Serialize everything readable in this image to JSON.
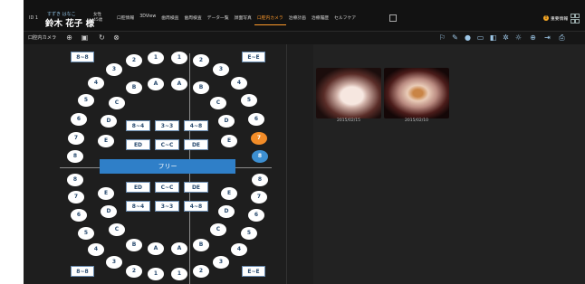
{
  "header": {
    "patient_id": "ID 1",
    "patient_kana": "すずき はなこ",
    "patient_name": "鈴木 花子 様",
    "patient_gender": "女性",
    "patient_age": "45歳",
    "tabs": [
      "口腔情報",
      "3DView",
      "歯周検査",
      "歯周検査",
      "データ一覧",
      "顔面写真",
      "口腔内カメラ",
      "治療計画",
      "治療履歴",
      "セルフケア"
    ],
    "active_tab": "口腔内カメラ",
    "notice_label": "重要情報"
  },
  "toolbar": {
    "title": "口腔内カメラ"
  },
  "chart": {
    "free_label": "フリー",
    "tags": {
      "ul": "8~8",
      "ur": "E~E",
      "ll": "8~8",
      "lr": "E~E",
      "r1a": "8~4",
      "r1b": "3~3",
      "r1c": "4~8",
      "r2a": "ED",
      "r2b": "C~C",
      "r2c": "DE",
      "r3a": "ED",
      "r3b": "C~C",
      "r3c": "DE",
      "r4a": "8~4",
      "r4b": "3~3",
      "r4c": "4~8"
    },
    "teeth": [
      {
        "label": "2"
      },
      {
        "label": "1"
      },
      {
        "label": "1"
      },
      {
        "label": "2"
      },
      {
        "label": "3"
      },
      {
        "label": "3"
      },
      {
        "label": "4"
      },
      {
        "label": "B"
      },
      {
        "label": "A"
      },
      {
        "label": "A"
      },
      {
        "label": "B"
      },
      {
        "label": "4"
      },
      {
        "label": "5"
      },
      {
        "label": "C"
      },
      {
        "label": "C"
      },
      {
        "label": "5"
      },
      {
        "label": "6"
      },
      {
        "label": "D"
      },
      {
        "label": "D"
      },
      {
        "label": "6"
      },
      {
        "label": "7"
      },
      {
        "label": "E"
      },
      {
        "label": "E"
      },
      {
        "label": "7"
      },
      {
        "label": "8"
      },
      {
        "label": "8"
      },
      {
        "label": "8"
      },
      {
        "label": "8"
      },
      {
        "label": "7"
      },
      {
        "label": "E"
      },
      {
        "label": "E"
      },
      {
        "label": "7"
      },
      {
        "label": "6"
      },
      {
        "label": "D"
      },
      {
        "label": "D"
      },
      {
        "label": "6"
      },
      {
        "label": "5"
      },
      {
        "label": "C"
      },
      {
        "label": "C"
      },
      {
        "label": "5"
      },
      {
        "label": "4"
      },
      {
        "label": "B"
      },
      {
        "label": "A"
      },
      {
        "label": "A"
      },
      {
        "label": "B"
      },
      {
        "label": "4"
      },
      {
        "label": "3"
      },
      {
        "label": "3"
      },
      {
        "label": "2"
      },
      {
        "label": "1"
      },
      {
        "label": "1"
      },
      {
        "label": "2"
      }
    ]
  },
  "photos": [
    {
      "date": "2015/02/15"
    },
    {
      "date": "2015/02/10"
    }
  ]
}
